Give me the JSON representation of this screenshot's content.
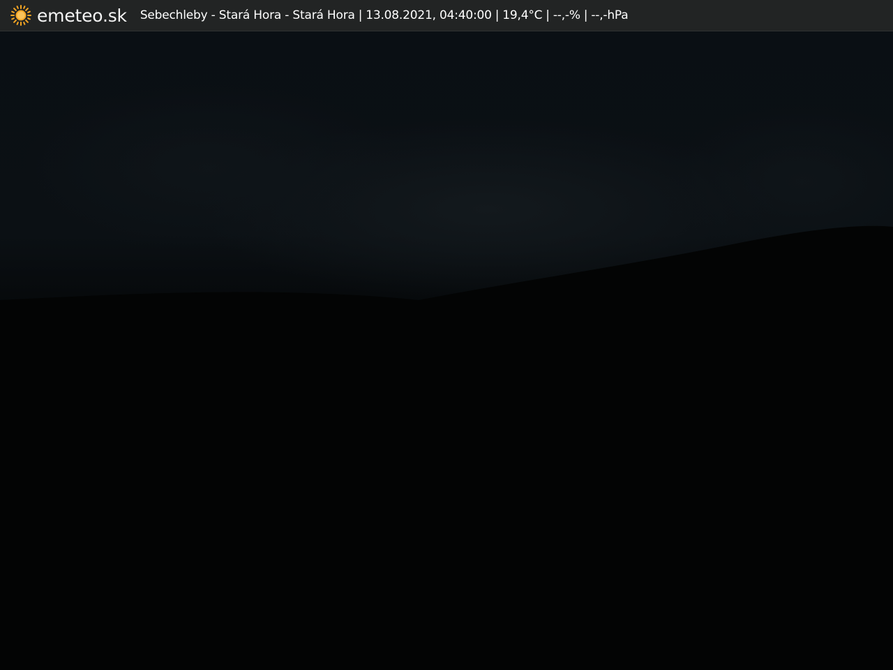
{
  "header": {
    "logo_icon": "sun-icon",
    "brand": "emeteo.sk",
    "location": "Sebechleby - Stará Hora - Stará Hora",
    "separator": "|",
    "datetime": "13.08.2021, 04:40:00",
    "temperature": "19,4°C",
    "humidity": "--,-%",
    "pressure": "--,-hPa"
  },
  "colors": {
    "bar_background": "#222424",
    "sun": "#f5a623",
    "text": "#ffffff"
  }
}
